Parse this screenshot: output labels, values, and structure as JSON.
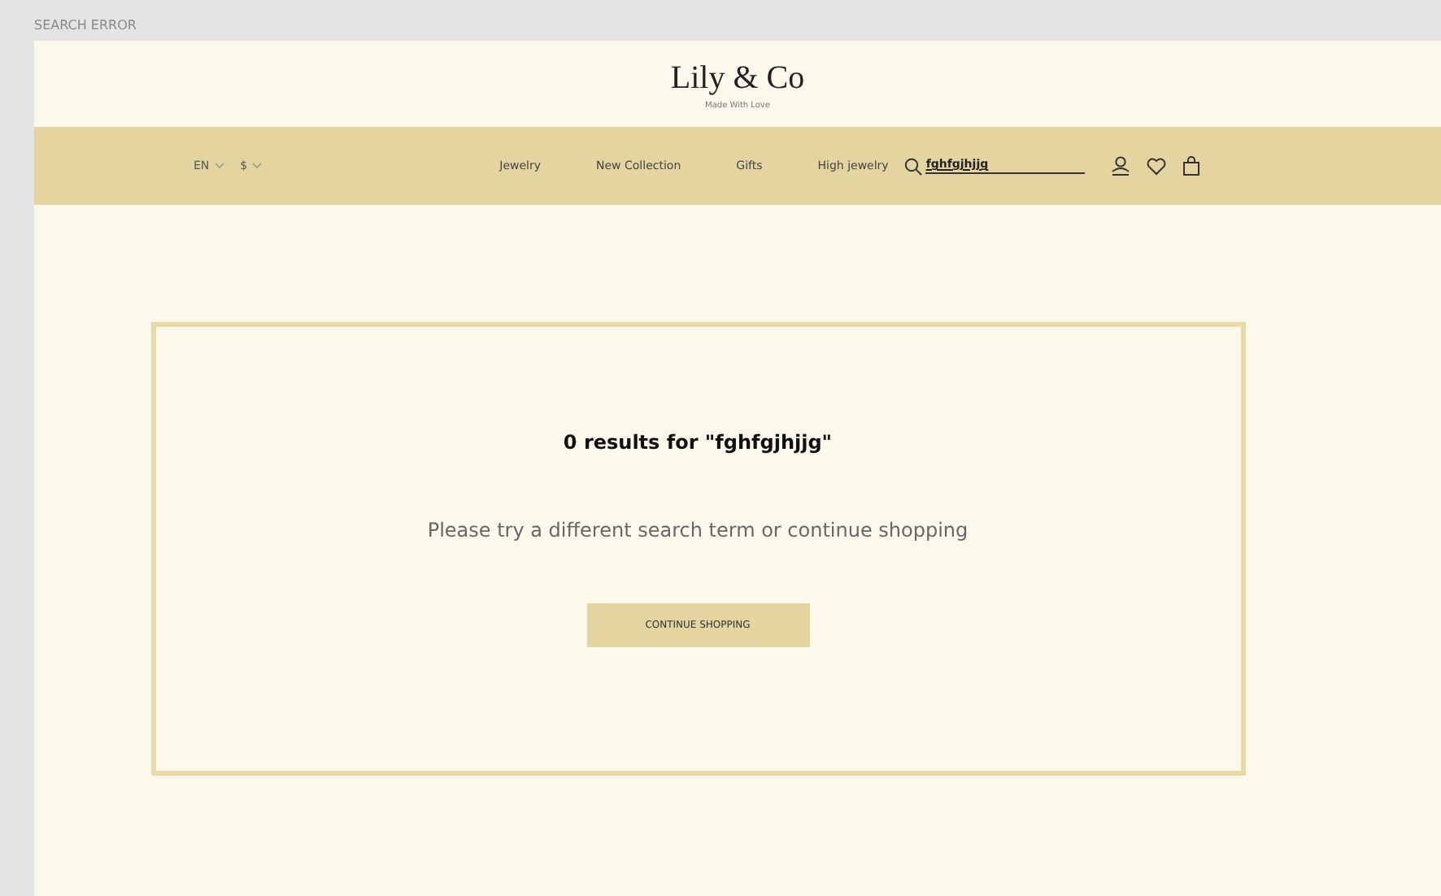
{
  "frame_label": "SEARCH ERROR",
  "brand": {
    "name": "Lily & Co",
    "tagline": "Made With Love"
  },
  "selectors": [
    {
      "label": "EN"
    },
    {
      "label": "$"
    }
  ],
  "nav_links": [
    "Jewelry",
    "New Collection",
    "Gifts",
    "High jewelry"
  ],
  "search": {
    "value": "fghfgjhjjg"
  },
  "result": {
    "heading": "0 results for \"fghfgjhjjg\"",
    "message": "Please try a different search term or continue shopping",
    "button": "CONTINUE SHOPPING"
  }
}
